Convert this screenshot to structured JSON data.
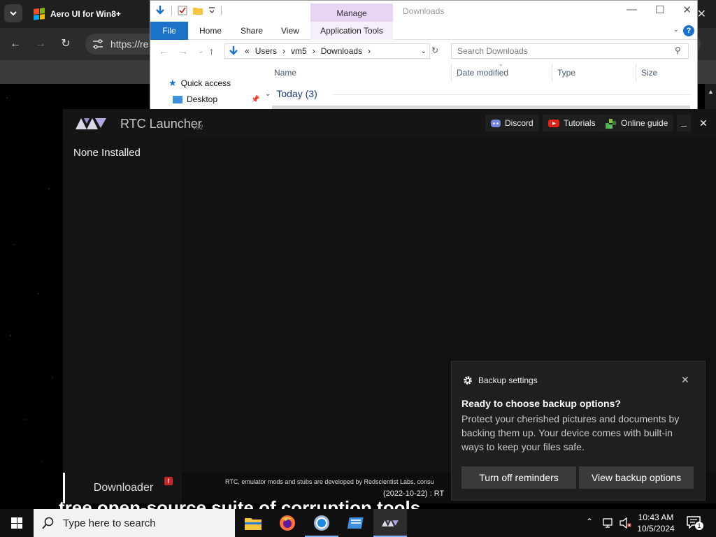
{
  "browser": {
    "tab_title": "Aero UI for Win8+",
    "url": "https://re",
    "close_symbol": "✕"
  },
  "explorer": {
    "window_title": "Downloads",
    "manage_tab": "Manage",
    "ribbon_tabs": [
      "File",
      "Home",
      "Share",
      "View",
      "Application Tools"
    ],
    "breadcrumb": [
      "«",
      "Users",
      "vm5",
      "Downloads"
    ],
    "search_placeholder": "Search Downloads",
    "columns": [
      "Name",
      "Date modified",
      "Type",
      "Size"
    ],
    "nav_items": [
      "Quick access",
      "Desktop"
    ],
    "group_header": "Today (3)",
    "help_symbol": "?"
  },
  "rtc": {
    "title": "RTC Launcher",
    "version": "v32",
    "links": [
      "Discord",
      "Tutorials",
      "Online guide"
    ],
    "minimize_symbol": "_",
    "close_symbol": "✕",
    "sidebar_title": "None Installed",
    "downloader_label": "Downloader",
    "badge": "!",
    "footer_text": "RTC, emulator mods and stubs are developed by Redscientist Labs, consu",
    "footer_date": "(2022-10-22) : RT"
  },
  "subtitle": "tree open-source suite of corruption tools",
  "toast": {
    "app_name": "Backup settings",
    "heading": "Ready to choose backup options?",
    "body": "Protect your cherished pictures and documents by backing them up. Your device comes with built-in ways to keep your files safe.",
    "btn_off": "Turn off reminders",
    "btn_view": "View backup options",
    "close_symbol": "✕"
  },
  "taskbar": {
    "search_placeholder": "Type here to search",
    "time": "10:43 AM",
    "date": "10/5/2024",
    "notification_count": "1"
  },
  "colors": {
    "accent_blue": "#1a73c8",
    "manage_tab": "#e8d4f5",
    "rtc_bg": "#121212",
    "toast_bg": "#1f1f1f",
    "badge_red": "#c62828"
  }
}
